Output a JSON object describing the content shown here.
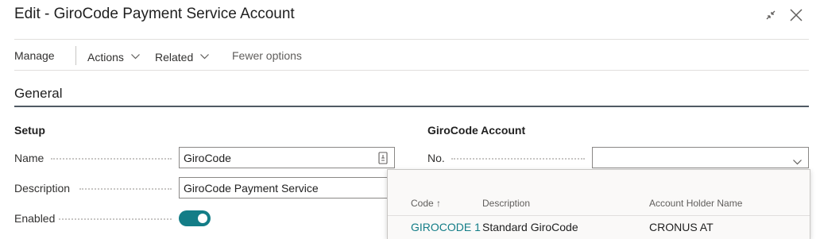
{
  "window": {
    "title": "Edit - GiroCode Payment Service Account",
    "collapse_icon": "collapse-icon",
    "close_icon": "close-icon"
  },
  "toolbar": {
    "manage": "Manage",
    "actions": "Actions",
    "related": "Related",
    "fewer_options": "Fewer options"
  },
  "section": {
    "title": "General"
  },
  "setup": {
    "heading": "Setup",
    "name_label": "Name",
    "name_value": "GiroCode",
    "description_label": "Description",
    "description_value": "GiroCode Payment Service",
    "enabled_label": "Enabled",
    "enabled": true
  },
  "account": {
    "heading": "GiroCode Account",
    "no_label": "No.",
    "no_value": ""
  },
  "lookup": {
    "columns": [
      "Code",
      "Description",
      "Account Holder Name"
    ],
    "sort_indicator": "↑",
    "rows": [
      {
        "code": "GIROCODE 1",
        "description": "Standard GiroCode",
        "holder": "CRONUS AT"
      }
    ]
  },
  "colors": {
    "accent": "#137d87",
    "text": "#212121",
    "border": "#8a8886"
  }
}
